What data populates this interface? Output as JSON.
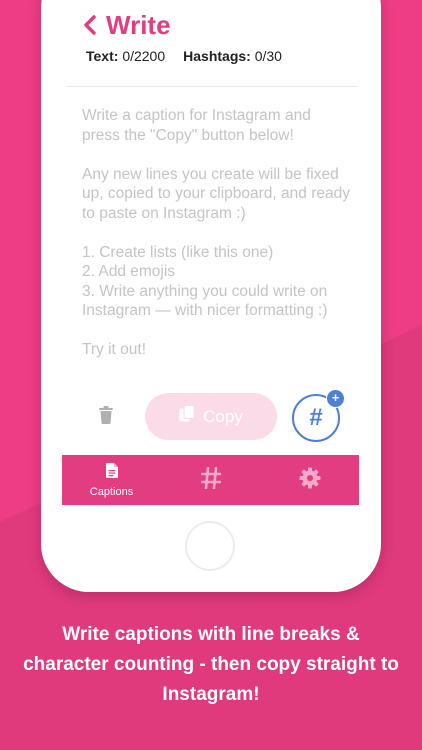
{
  "header": {
    "title": "Write",
    "text_label": "Text:",
    "text_count": "0/2200",
    "hashtags_label": "Hashtags:",
    "hashtags_count": "0/30"
  },
  "editor": {
    "placeholder": "Write a caption for Instagram and press the \"Copy\" button below!\n\nAny new lines you create will be fixed up, copied to your clipboard, and ready to paste on Instagram :)\n\n1. Create lists (like this one)\n2. Add emojis\n3. Write anything you could write on Instagram — with nicer formatting :)\n\nTry it out!",
    "value": ""
  },
  "actions": {
    "copy_label": "Copy",
    "hashtag_symbol": "#",
    "badge_symbol": "+"
  },
  "tabbar": {
    "captions_label": "Captions"
  },
  "marketing": {
    "tagline": "Write captions with line breaks & character counting - then copy straight to Instagram!"
  },
  "colors": {
    "background": "#ee3d84",
    "accent": "#e23d80",
    "copy_button": "#fbdbe7",
    "hashtag_blue": "#4f7fd8"
  },
  "icons": [
    "back-chevron-icon",
    "trash-icon",
    "copy-icon",
    "hashtag-icon",
    "plus-icon",
    "document-icon",
    "gear-icon"
  ]
}
